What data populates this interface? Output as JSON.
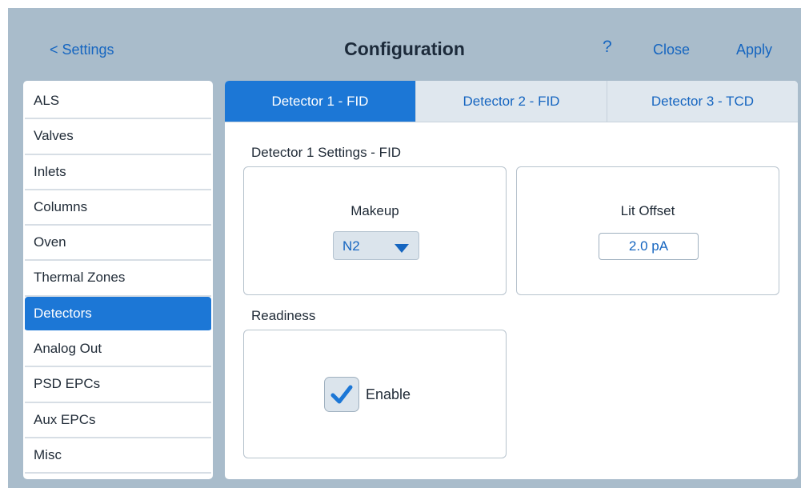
{
  "header": {
    "back_label": "< Settings",
    "title": "Configuration",
    "help_label": "?",
    "close_label": "Close",
    "apply_label": "Apply"
  },
  "sidebar": {
    "items": [
      {
        "label": "ALS"
      },
      {
        "label": "Valves"
      },
      {
        "label": "Inlets"
      },
      {
        "label": "Columns"
      },
      {
        "label": "Oven"
      },
      {
        "label": "Thermal Zones"
      },
      {
        "label": "Detectors",
        "active": true
      },
      {
        "label": "Analog Out"
      },
      {
        "label": "PSD EPCs"
      },
      {
        "label": "Aux EPCs"
      },
      {
        "label": "Misc"
      }
    ]
  },
  "tabs": [
    {
      "label": "Detector 1 - FID",
      "active": true
    },
    {
      "label": "Detector 2 - FID"
    },
    {
      "label": "Detector 3 - TCD"
    }
  ],
  "detector_settings": {
    "title": "Detector 1 Settings - FID",
    "makeup": {
      "label": "Makeup",
      "value": "N2",
      "icon": "chevron-down-icon"
    },
    "lit_offset": {
      "label": "Lit Offset",
      "value": "2.0 pA"
    }
  },
  "readiness": {
    "title": "Readiness",
    "enable_label": "Enable",
    "enabled": true,
    "icon": "check-icon"
  },
  "colors": {
    "accent": "#1c77d6",
    "link": "#1565c0",
    "background": "#a9bccb",
    "tab_inactive": "#dfe7ee"
  }
}
